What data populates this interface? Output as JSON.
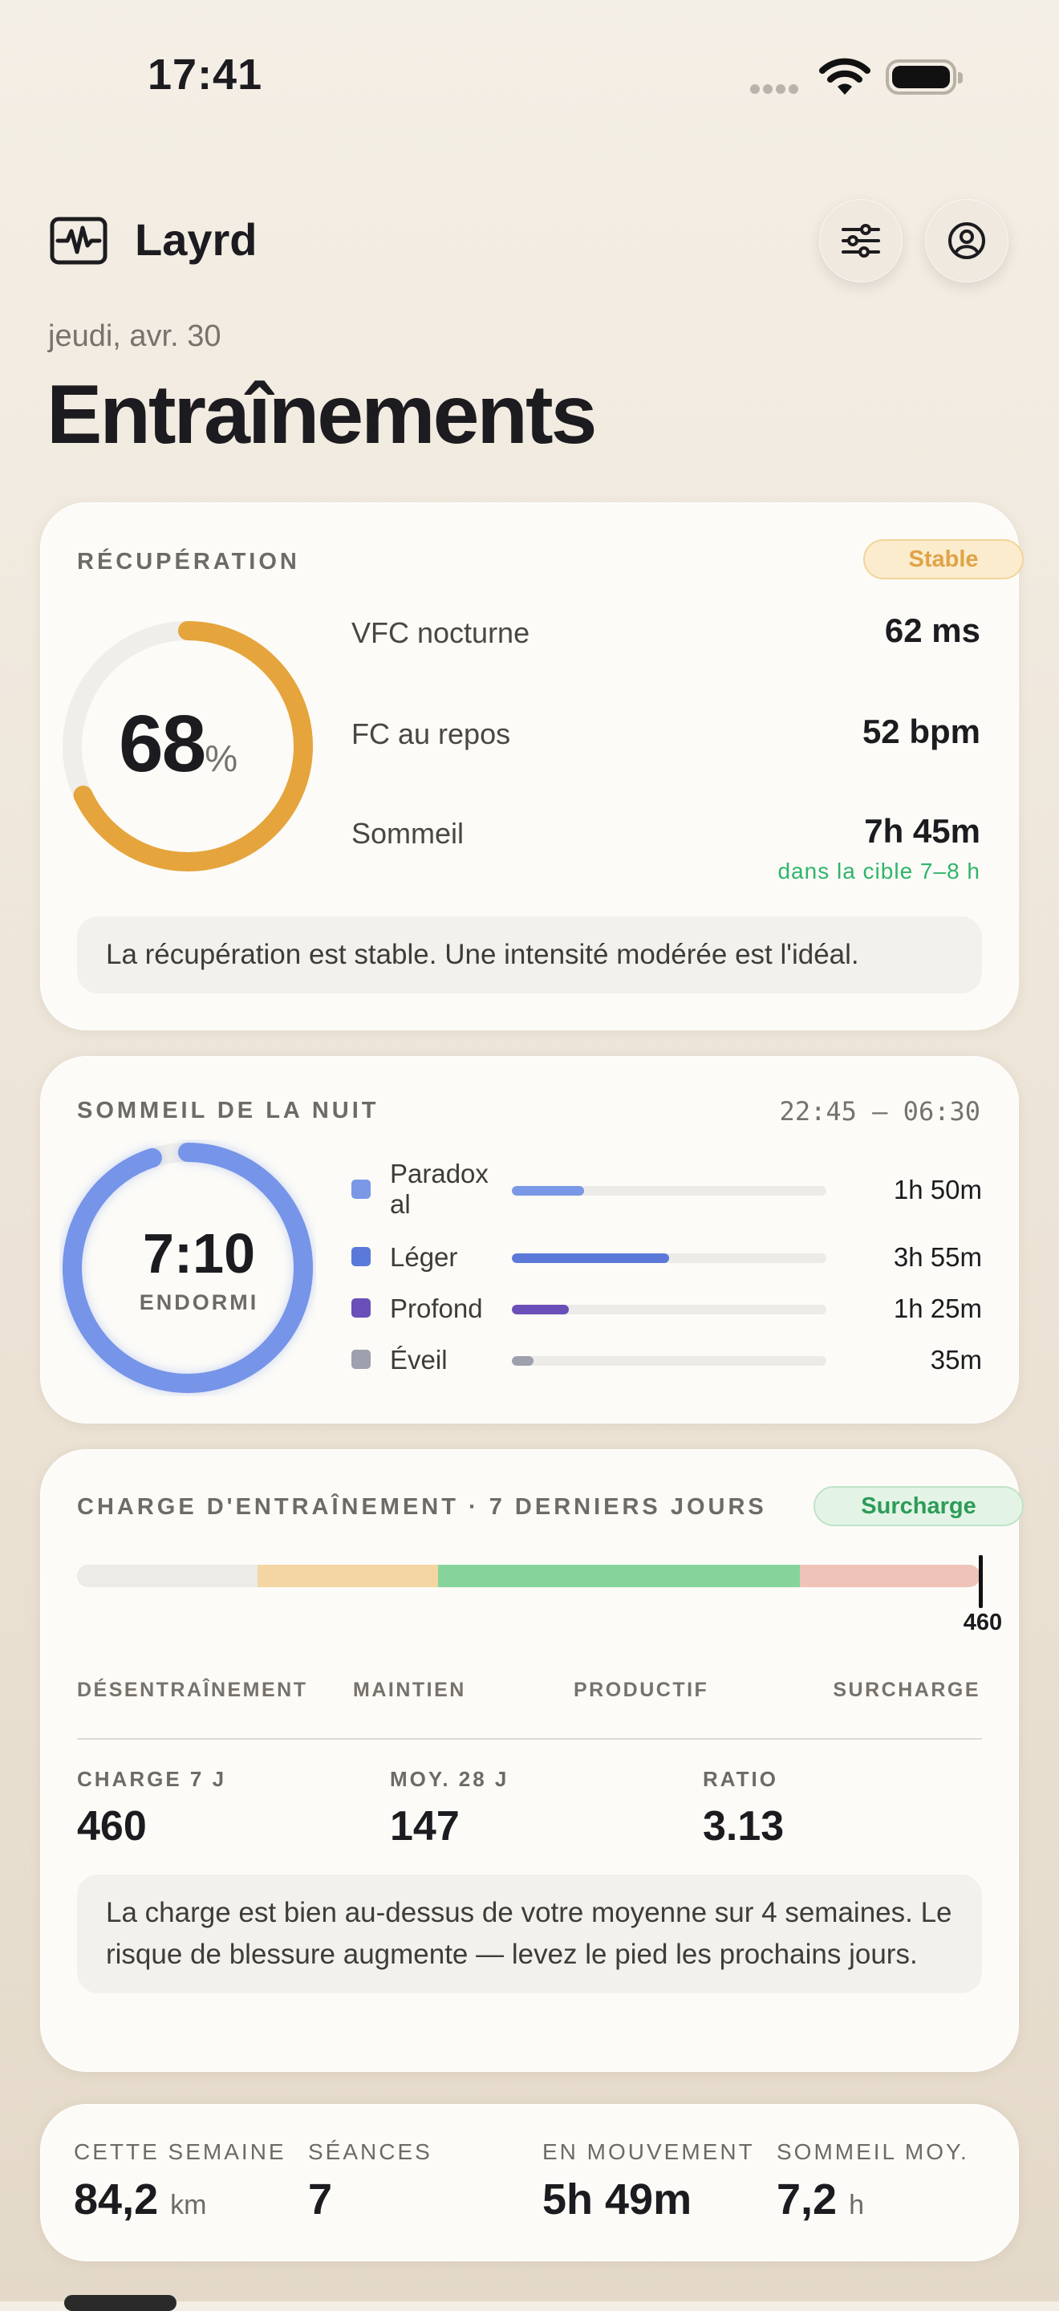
{
  "status_bar": {
    "time": "17:41"
  },
  "header": {
    "app_name": "Layrd",
    "date": "jeudi, avr. 30",
    "title": "Entraînements"
  },
  "recovery": {
    "label": "RÉCUPÉRATION",
    "badge": "Stable",
    "score": "68",
    "score_unit": "%",
    "score_fraction": 0.68,
    "metrics": [
      {
        "label": "VFC nocturne",
        "value": "62 ms"
      },
      {
        "label": "FC au repos",
        "value": "52 bpm"
      },
      {
        "label": "Sommeil",
        "value": "7h 45m"
      }
    ],
    "sleep_note": "dans la cible 7–8 h",
    "message": "La récupération est stable. Une intensité modérée est l'idéal.",
    "accent_color": "#e5a43c"
  },
  "sleep": {
    "label": "SOMMEIL DE LA NUIT",
    "range": "22:45 — 06:30",
    "asleep": "7:10",
    "asleep_label": "ENDORMI",
    "ring_color": "#7694e8",
    "stages": [
      {
        "name": "Paradox al",
        "duration": "1h 50m",
        "color": "#7a98e6",
        "fraction": 0.23
      },
      {
        "name": "Léger",
        "duration": "3h 55m",
        "color": "#5a79d9",
        "fraction": 0.5
      },
      {
        "name": "Profond",
        "duration": "1h 25m",
        "color": "#6a4fb8",
        "fraction": 0.18
      },
      {
        "name": "Éveil",
        "duration": "35m",
        "color": "#9ea0ad",
        "fraction": 0.07
      }
    ]
  },
  "load": {
    "label": "CHARGE D'ENTRAÎNEMENT · 7 DERNIERS JOURS",
    "badge": "Surcharge",
    "marker_value": "460",
    "zones": [
      {
        "name": "DÉSENTRAÎNEMENT",
        "color": "#ecebe8",
        "share": 0.2
      },
      {
        "name": "MAINTIEN",
        "color": "#f3d6a4",
        "share": 0.2
      },
      {
        "name": "PRODUCTIF",
        "color": "#86d49c",
        "share": 0.4
      },
      {
        "name": "SURCHARGE",
        "color": "#efc4b8",
        "share": 0.2
      }
    ],
    "stats": [
      {
        "label": "CHARGE 7 J",
        "value": "460"
      },
      {
        "label": "MOY. 28 J",
        "value": "147"
      },
      {
        "label": "RATIO",
        "value": "3.13"
      }
    ],
    "message": "La charge est bien au-dessus de votre moyenne sur 4 semaines. Le risque de blessure augmente — levez le pied les prochains jours."
  },
  "week": [
    {
      "label": "CETTE SEMAINE",
      "value": "84,2",
      "unit": "km"
    },
    {
      "label": "SÉANCES",
      "value": "7",
      "unit": ""
    },
    {
      "label": "EN MOUVEMENT",
      "value": "5h 49m",
      "unit": ""
    },
    {
      "label": "SOMMEIL MOY.",
      "value": "7,2",
      "unit": "h"
    }
  ]
}
